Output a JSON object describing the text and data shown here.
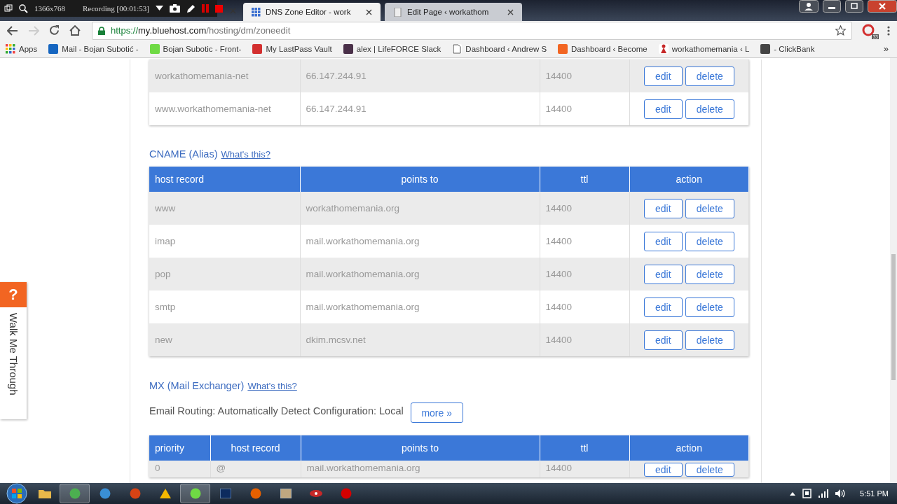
{
  "recorder": {
    "resolution": "1366x768",
    "status": "Recording [00:01:53]"
  },
  "tabs": [
    {
      "title": "DNS Zone Editor - work",
      "selected": true
    },
    {
      "title": "Edit Page ‹ workathom",
      "selected": false
    }
  ],
  "address": {
    "scheme": "https://",
    "host": "my.bluehost.com",
    "path": "/hosting/dm/zoneedit"
  },
  "extension_badge": "33",
  "bookmarks": [
    {
      "label": "Apps",
      "kind": "grid"
    },
    {
      "label": "Mail - Bojan Subotić -",
      "kind": "outlook"
    },
    {
      "label": "Bojan Subotic - Front-",
      "kind": "upwork"
    },
    {
      "label": "My LastPass Vault",
      "kind": "lastpass"
    },
    {
      "label": "alex | LifeFORCE Slack",
      "kind": "slack"
    },
    {
      "label": "Dashboard ‹ Andrew S",
      "kind": "page"
    },
    {
      "label": "Dashboard ‹ Become",
      "kind": "orange"
    },
    {
      "label": "workathomemania ‹ L",
      "kind": "figure"
    },
    {
      "label": "- ClickBank",
      "kind": "search"
    }
  ],
  "bookmarks_more": "»",
  "a_records": {
    "rows": [
      {
        "host": "workathomemania-net",
        "points_to": "66.147.244.91",
        "ttl": "14400",
        "actions": [
          "edit",
          "delete"
        ]
      },
      {
        "host": "www.workathomemania-net",
        "points_to": "66.147.244.91",
        "ttl": "14400",
        "actions": [
          "edit",
          "delete"
        ]
      }
    ]
  },
  "cname": {
    "title": "CNAME (Alias)",
    "help_link": "What's this?",
    "columns": [
      "host record",
      "points to",
      "ttl",
      "action"
    ],
    "rows": [
      {
        "host": "www",
        "points_to": "workathomemania.org",
        "ttl": "14400",
        "actions": [
          "edit",
          "delete"
        ]
      },
      {
        "host": "imap",
        "points_to": "mail.workathomemania.org",
        "ttl": "14400",
        "actions": [
          "edit",
          "delete"
        ]
      },
      {
        "host": "pop",
        "points_to": "mail.workathomemania.org",
        "ttl": "14400",
        "actions": [
          "edit",
          "delete"
        ]
      },
      {
        "host": "smtp",
        "points_to": "mail.workathomemania.org",
        "ttl": "14400",
        "actions": [
          "edit",
          "delete"
        ]
      },
      {
        "host": "new",
        "points_to": "dkim.mcsv.net",
        "ttl": "14400",
        "actions": [
          "edit",
          "delete"
        ]
      }
    ]
  },
  "mx": {
    "title": "MX (Mail Exchanger)",
    "help_link": "What's this?",
    "routing": "Email Routing: Automatically Detect Configuration: Local",
    "more_button": "more »",
    "columns": [
      "priority",
      "host record",
      "points to",
      "ttl",
      "action"
    ],
    "rows": [
      {
        "priority": "0",
        "host": "@",
        "points_to": "mail.workathomemania.org",
        "ttl": "14400",
        "actions": [
          "edit",
          "delete"
        ]
      }
    ]
  },
  "walkme": {
    "icon": "?",
    "label": "Walk Me Through"
  },
  "taskbar": {
    "apps": [
      {
        "kind": "folder",
        "selected": false
      },
      {
        "kind": "chrome",
        "selected": true
      },
      {
        "kind": "network",
        "selected": false
      },
      {
        "kind": "ccleaner",
        "selected": false
      },
      {
        "kind": "triangle",
        "selected": false
      },
      {
        "kind": "upwork",
        "selected": true
      },
      {
        "kind": "photoshop",
        "selected": false
      },
      {
        "kind": "firefox",
        "selected": false
      },
      {
        "kind": "window",
        "selected": false
      },
      {
        "kind": "eye",
        "selected": false
      },
      {
        "kind": "record",
        "selected": false
      }
    ],
    "clock": "5:51 PM"
  }
}
